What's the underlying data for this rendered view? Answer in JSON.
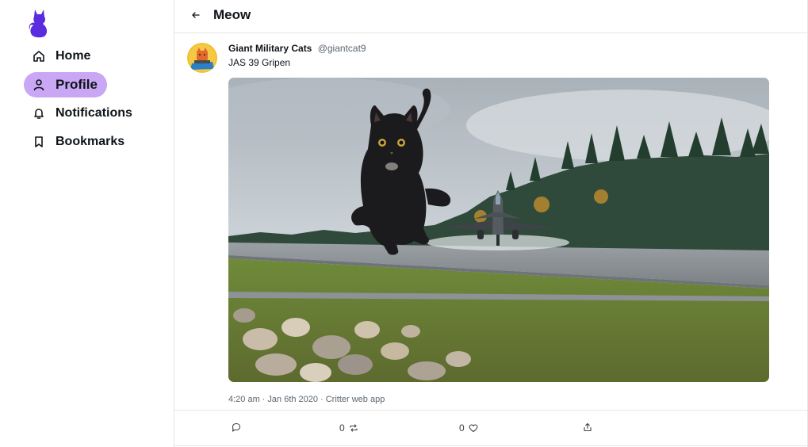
{
  "sidebar": {
    "logo_icon": "cat-logo-icon",
    "brand_color": "#5b2be0",
    "items": [
      {
        "label": "Home",
        "icon": "home-icon"
      },
      {
        "label": "Profile",
        "icon": "user-icon",
        "active": true
      },
      {
        "label": "Notifications",
        "icon": "bell-icon"
      },
      {
        "label": "Bookmarks",
        "icon": "bookmark-icon"
      }
    ],
    "active_color": "#c9a7f5"
  },
  "header": {
    "back_icon": "arrow-left-icon",
    "title": "Meow"
  },
  "post": {
    "author": {
      "display_name": "Giant Military Cats",
      "handle": "@giantcat9"
    },
    "text": "JAS 39 Gripen",
    "meta": {
      "time": "4:20 am",
      "date": "Jan 6th 2020",
      "client": "Critter web app",
      "separator": "·"
    },
    "actions": {
      "reply_icon": "reply-icon",
      "repost_count": "0",
      "repost_icon": "repost-icon",
      "like_count": "0",
      "like_icon": "heart-icon",
      "share_icon": "share-icon"
    }
  }
}
